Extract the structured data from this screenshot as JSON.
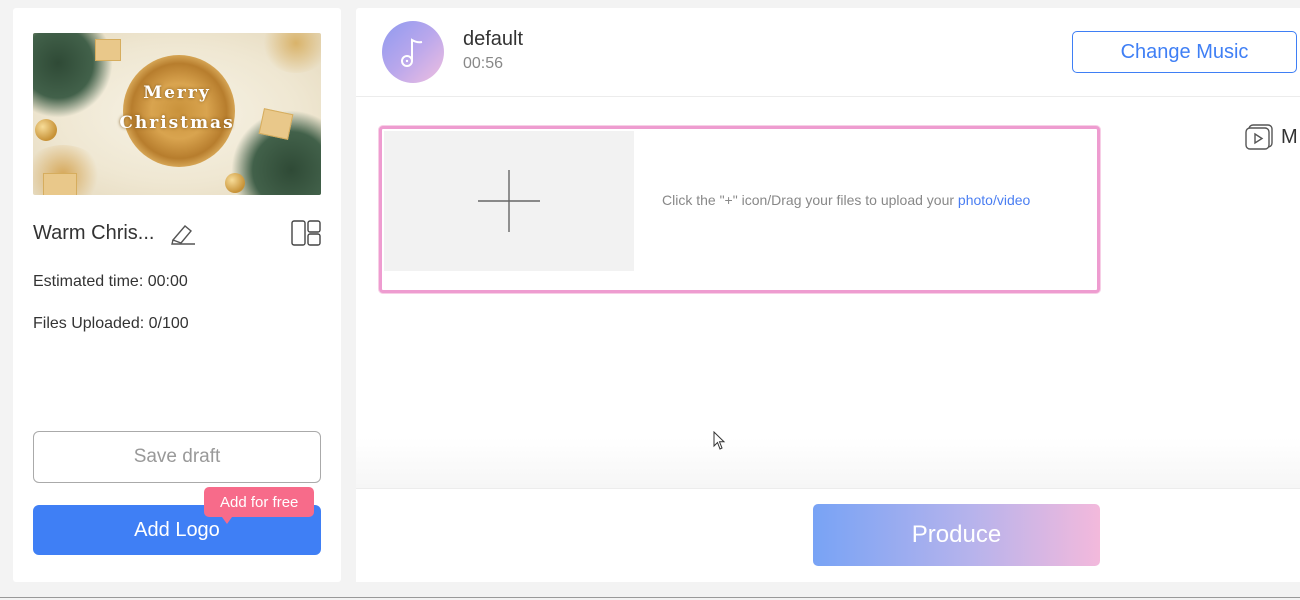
{
  "project": {
    "thumbnail_text_line1": "Merry",
    "thumbnail_text_line2": "Christmas",
    "title": "Warm Chris...",
    "estimated_time": "Estimated time: 00:00",
    "files_uploaded": "Files Uploaded: 0/100"
  },
  "actions": {
    "save_draft": "Save draft",
    "add_logo": "Add Logo",
    "add_for_free_badge": "Add for free",
    "produce": "Produce"
  },
  "music": {
    "name": "default",
    "duration": "00:56",
    "change_music": "Change Music"
  },
  "upload": {
    "hint_prefix": "Click the \"+\" icon/Drag your files to upload your ",
    "hint_link": "photo/video"
  },
  "side_tool": {
    "label": "M",
    "icon": "video-play-icon"
  },
  "colors": {
    "accent": "#3f7ff5",
    "badge": "#f76b8a",
    "upload_border": "#ee9cd0"
  }
}
